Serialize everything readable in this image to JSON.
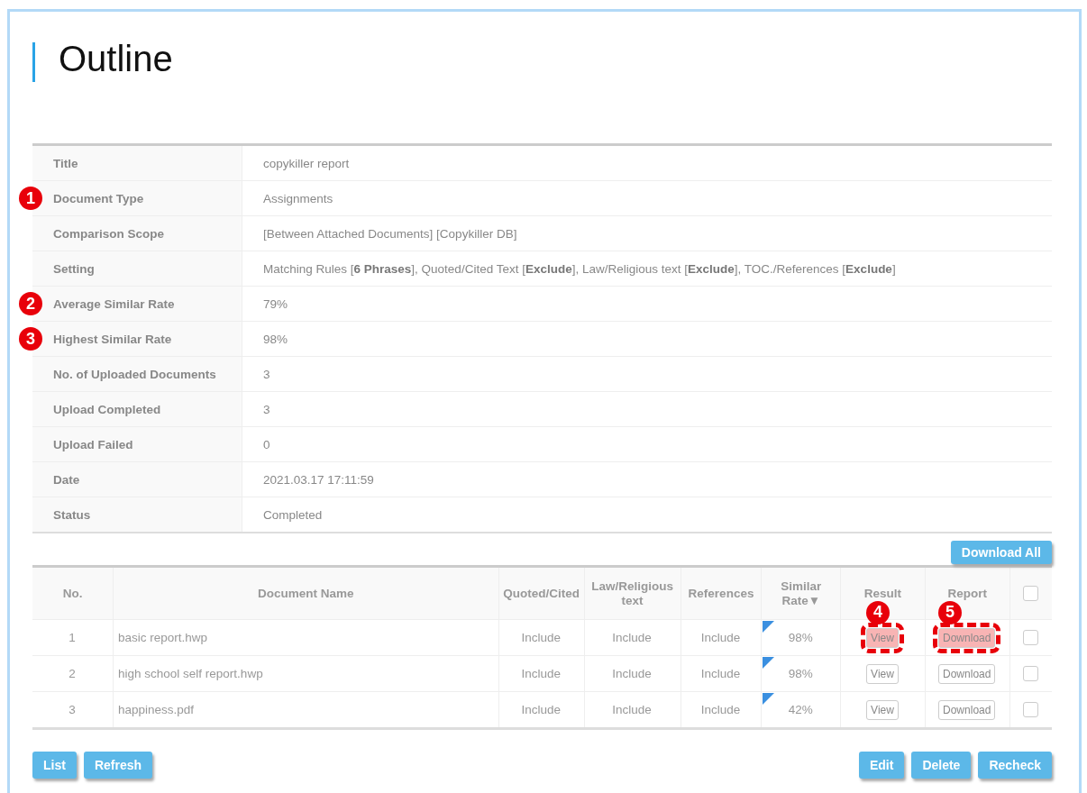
{
  "page_title": "Outline",
  "info": [
    {
      "label": "Title",
      "value": "copykiller report"
    },
    {
      "label": "Document Type",
      "value": "Assignments",
      "callout": "1"
    },
    {
      "label": "Comparison Scope",
      "value": "[Between Attached Documents] [Copykiller DB]"
    },
    {
      "label": "Setting",
      "value": "Matching Rules [**6 Phrases**], Quoted/Cited Text [**Exclude**], Law/Religious text [**Exclude**], TOC./References [**Exclude**]"
    },
    {
      "label": "Average Similar Rate",
      "value": "79%",
      "callout": "2"
    },
    {
      "label": "Highest Similar Rate",
      "value": "98%",
      "callout": "3"
    },
    {
      "label": "No. of Uploaded Documents",
      "value": "3"
    },
    {
      "label": "Upload Completed",
      "value": "3"
    },
    {
      "label": "Upload Failed",
      "value": "0"
    },
    {
      "label": "Date",
      "value": "2021.03.17 17:11:59"
    },
    {
      "label": "Status",
      "value": "Completed"
    }
  ],
  "download_all": "Download All",
  "table": {
    "columns": [
      "No.",
      "Document Name",
      "Quoted/Cited",
      "Law/Religious text",
      "References",
      "Similar Rate▼",
      "Result",
      "Report"
    ],
    "header_checkbox": {
      "checked": false
    },
    "rows": [
      {
        "no": "1",
        "name": "basic report.hwp",
        "quoted": "Include",
        "law": "Include",
        "references": "Include",
        "rate": "98%",
        "result": {
          "label": "View",
          "highlighted": true,
          "callout": "4"
        },
        "report": {
          "label": "Download",
          "highlighted": true,
          "callout": "5"
        },
        "checked": false
      },
      {
        "no": "2",
        "name": "high school self report.hwp",
        "quoted": "Include",
        "law": "Include",
        "references": "Include",
        "rate": "98%",
        "result": {
          "label": "View",
          "highlighted": false
        },
        "report": {
          "label": "Download",
          "highlighted": false
        },
        "checked": false
      },
      {
        "no": "3",
        "name": "happiness.pdf",
        "quoted": "Include",
        "law": "Include",
        "references": "Include",
        "rate": "42%",
        "result": {
          "label": "View",
          "highlighted": false
        },
        "report": {
          "label": "Download",
          "highlighted": false
        },
        "checked": false
      }
    ]
  },
  "left_buttons": [
    "List",
    "Refresh"
  ],
  "right_buttons": [
    "Edit",
    "Delete",
    "Recheck"
  ]
}
